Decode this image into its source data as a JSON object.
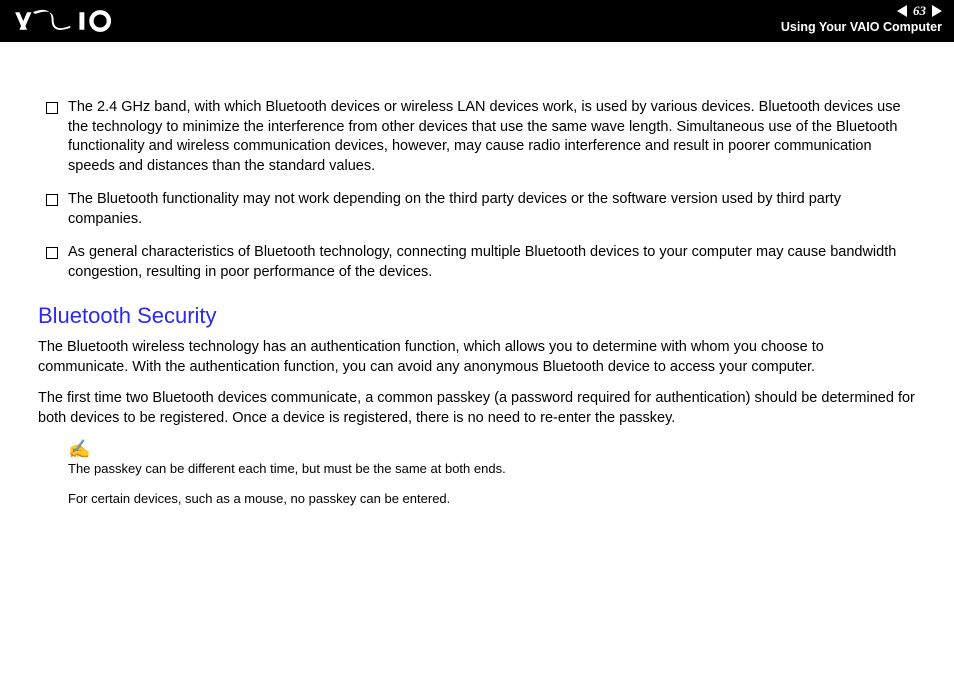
{
  "header": {
    "page_number": "63",
    "subtitle": "Using Your VAIO Computer"
  },
  "bullets": [
    "The 2.4 GHz band, with which Bluetooth devices or wireless LAN devices work, is used by various devices. Bluetooth devices use the technology to minimize the interference from other devices that use the same wave length. Simultaneous use of the Bluetooth functionality and wireless communication devices, however, may cause radio interference and result in poorer communication speeds and distances than the standard values.",
    "The Bluetooth functionality may not work depending on the third party devices or the software version used by third party companies.",
    "As general characteristics of Bluetooth technology, connecting multiple Bluetooth devices to your computer may cause bandwidth congestion, resulting in poor performance of the devices."
  ],
  "section_title": "Bluetooth Security",
  "paragraphs": [
    "The Bluetooth wireless technology has an authentication function, which allows you to determine with whom you choose to communicate. With the authentication function, you can avoid any anonymous Bluetooth device to access your computer.",
    "The first time two Bluetooth devices communicate, a common passkey (a password required for authentication) should be determined for both devices to be registered. Once a device is registered, there is no need to re-enter the passkey."
  ],
  "notes": [
    "The passkey can be different each time, but must be the same at both ends.",
    "For certain devices, such as a mouse, no passkey can be entered."
  ]
}
